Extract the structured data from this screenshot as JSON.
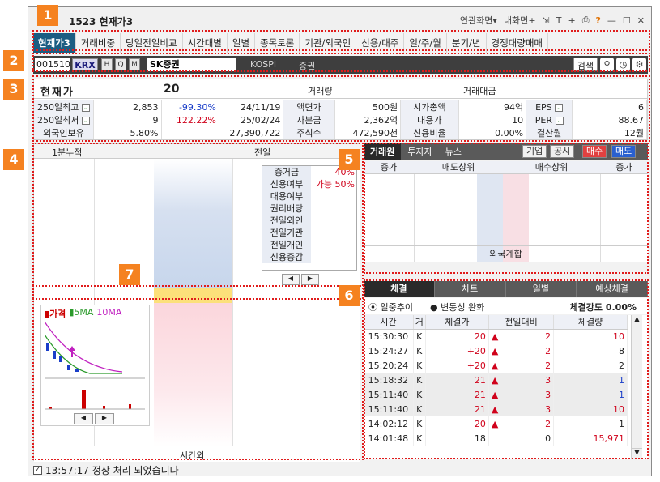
{
  "window": {
    "code": "1523",
    "title": "현재가3",
    "linked": "연관화면",
    "myscreen": "내화면",
    "help": "?"
  },
  "tabs": [
    "현재가3",
    "거래비중",
    "당일전일비교",
    "시간대별",
    "일별",
    "종목토론",
    "기관/외국인",
    "신용/대주",
    "일/주/월",
    "분기/년",
    "경쟁대량매매"
  ],
  "stock": {
    "code": "001510",
    "market": "KRX",
    "btns": [
      "H",
      "Q",
      "M"
    ],
    "name": "SK증권",
    "index": "KOSPI",
    "sector": "증권",
    "search": "검색"
  },
  "quote": {
    "label": "현재가",
    "price": "20",
    "vol_label": "거래량",
    "amt_label": "거래대금",
    "rows": [
      [
        "250일최고",
        "2,853",
        "-99.30%",
        "24/11/19",
        "액면가",
        "500원",
        "시가총액",
        "94억",
        "EPS",
        "6"
      ],
      [
        "250일최저",
        "9",
        "122.22%",
        "25/02/24",
        "자본금",
        "2,362억",
        "대용가",
        "10",
        "PER",
        "88.67"
      ],
      [
        "외국인보유",
        "5.80%",
        "",
        "27,390,722",
        "주식수",
        "472,590천",
        "신용비율",
        "0.00%",
        "결산월",
        "12월"
      ]
    ]
  },
  "left": {
    "h1": "1분누적",
    "h2": "전일",
    "timeout": "시간외",
    "info": [
      [
        "증거금",
        "40%"
      ],
      [
        "신용여부",
        "가능 50%"
      ],
      [
        "대용여부",
        ""
      ],
      [
        "권리배당",
        ""
      ],
      [
        "전일외인",
        ""
      ],
      [
        "전일기관",
        ""
      ],
      [
        "전일개인",
        ""
      ],
      [
        "신용증감",
        ""
      ]
    ],
    "legend": {
      "price": "가격",
      "ma5": "5MA",
      "ma10": "10MA"
    }
  },
  "right": {
    "tabs": [
      "거래원",
      "투자자",
      "뉴스"
    ],
    "btns": [
      "기업",
      "공시",
      "매수",
      "매도"
    ],
    "cols": [
      "증가",
      "매도상위",
      "매수상위",
      "증가"
    ],
    "foreign": "외국계합",
    "tabs2": [
      "체결",
      "차트",
      "일별",
      "예상체결"
    ],
    "radio1": "일중추이",
    "radio2": "변동성 완화",
    "strength_label": "체결강도",
    "strength": "0.00%",
    "thead": [
      "시간",
      "거",
      "체결가",
      "전일대비",
      "체결량"
    ],
    "trades": [
      [
        "15:30:30",
        "K",
        "20",
        "▲",
        "2",
        "10"
      ],
      [
        "15:24:27",
        "K",
        "+20",
        "▲",
        "2",
        "8"
      ],
      [
        "15:20:24",
        "K",
        "+20",
        "▲",
        "2",
        "2"
      ],
      [
        "15:18:32",
        "K",
        "21",
        "▲",
        "3",
        "1"
      ],
      [
        "15:11:40",
        "K",
        "21",
        "▲",
        "3",
        "1"
      ],
      [
        "15:11:40",
        "K",
        "21",
        "▲",
        "3",
        "10"
      ],
      [
        "14:02:12",
        "K",
        "20",
        "▲",
        "2",
        "1"
      ],
      [
        "14:01:48",
        "K",
        "18",
        "",
        "0",
        "15,971"
      ]
    ]
  },
  "status": "13:57:17 정상 처리 되었습니다",
  "badges": [
    "1",
    "2",
    "3",
    "4",
    "5",
    "6",
    "7"
  ]
}
